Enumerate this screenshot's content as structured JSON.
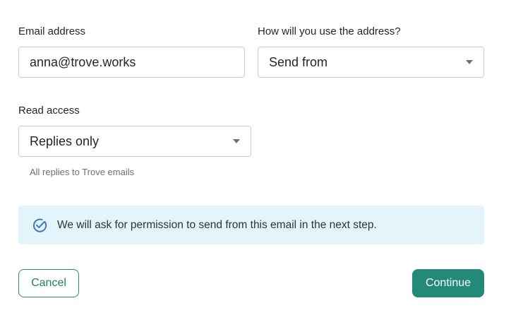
{
  "email": {
    "label": "Email address",
    "value": "anna@trove.works"
  },
  "usage": {
    "label": "How will you use the address?",
    "selected": "Send from"
  },
  "read_access": {
    "label": "Read access",
    "selected": "Replies only",
    "hint": "All replies to Trove emails"
  },
  "banner": {
    "icon": "check-circle-icon",
    "text": "We will ask for permission to send from this email in the next step."
  },
  "actions": {
    "cancel_label": "Cancel",
    "continue_label": "Continue"
  },
  "colors": {
    "accent": "#238a78",
    "banner_bg": "#e3f4fb",
    "banner_icon": "#3a7fb8"
  }
}
